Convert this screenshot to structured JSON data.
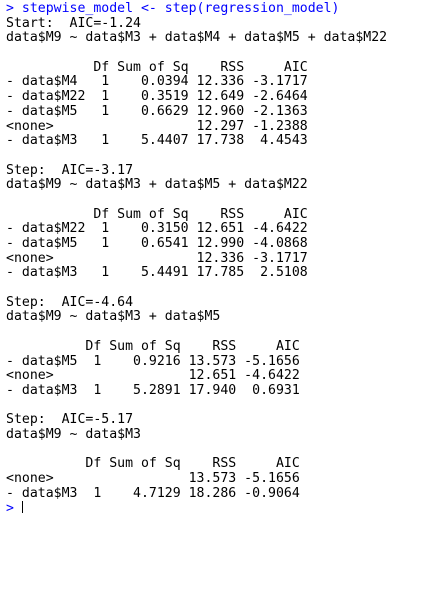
{
  "console": {
    "command": "> stepwise_model <- step(regression_model)",
    "output_lines": [
      "Start:  AIC=-1.24",
      "data$M9 ~ data$M3 + data$M4 + data$M5 + data$M22",
      "",
      "           Df Sum of Sq    RSS     AIC",
      "- data$M4   1    0.0394 12.336 -3.1717",
      "- data$M22  1    0.3519 12.649 -2.6464",
      "- data$M5   1    0.6629 12.960 -2.1363",
      "<none>                  12.297 -1.2388",
      "- data$M3   1    5.4407 17.738  4.4543",
      "",
      "Step:  AIC=-3.17",
      "data$M9 ~ data$M3 + data$M5 + data$M22",
      "",
      "           Df Sum of Sq    RSS     AIC",
      "- data$M22  1    0.3150 12.651 -4.6422",
      "- data$M5   1    0.6541 12.990 -4.0868",
      "<none>                  12.336 -3.1717",
      "- data$M3   1    5.4491 17.785  2.5108",
      "",
      "Step:  AIC=-4.64",
      "data$M9 ~ data$M3 + data$M5",
      "",
      "          Df Sum of Sq    RSS     AIC",
      "- data$M5  1    0.9216 13.573 -5.1656",
      "<none>                 12.651 -4.6422",
      "- data$M3  1    5.2891 17.940  0.6931",
      "",
      "Step:  AIC=-5.17",
      "data$M9 ~ data$M3",
      "",
      "          Df Sum of Sq    RSS     AIC",
      "<none>                 13.573 -5.1656",
      "- data$M3  1    4.7129 18.286 -0.9064"
    ],
    "prompt": "> "
  }
}
